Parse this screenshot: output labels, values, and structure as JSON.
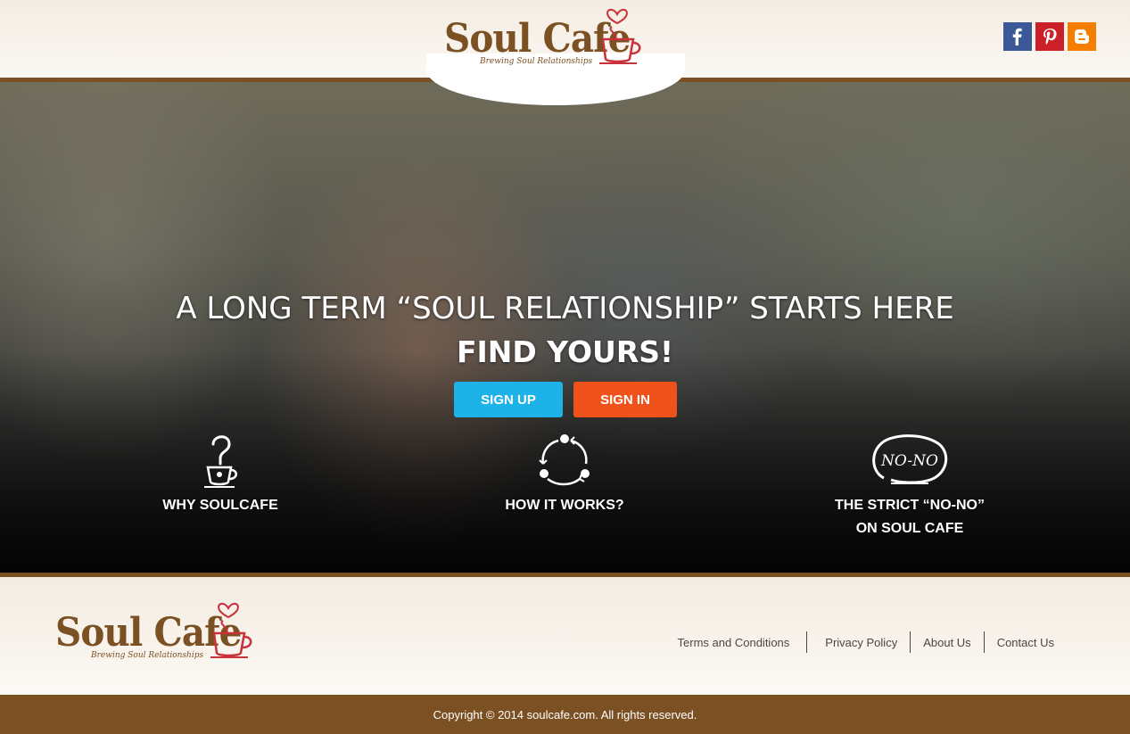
{
  "header": {
    "logo": {
      "word": "Soul Cafe",
      "tagline": "Brewing Soul Relationships"
    },
    "social": [
      {
        "name": "facebook",
        "icon": "facebook-icon",
        "color": "#3b5998"
      },
      {
        "name": "pinterest",
        "icon": "pinterest-icon",
        "color": "#cb2027"
      },
      {
        "name": "blogger",
        "icon": "blogger-icon",
        "color": "#f57d00"
      }
    ]
  },
  "hero": {
    "title": "A LONG TERM “SOUL RELATIONSHIP” STARTS HERE",
    "subtitle": "FIND YOURS!",
    "signup_label": "SIGN UP",
    "signin_label": "SIGN IN",
    "features": [
      {
        "label": "WHY SOULCAFE",
        "icon": "coffee-question-icon"
      },
      {
        "label": "HOW IT WORKS?",
        "icon": "cycle-icon"
      },
      {
        "label_line1": "THE STRICT “NO-NO”",
        "label_line2": "ON SOUL CAFE",
        "icon": "no-no-icon",
        "icon_text": "NO-NO"
      }
    ]
  },
  "footer": {
    "logo": {
      "word": "Soul Cafe",
      "tagline": "Brewing Soul Relationships"
    },
    "links": [
      "Terms and Conditions",
      "Privacy Policy",
      "About Us",
      "Contact Us"
    ],
    "copyright": "Copyright © 2014 soulcafe.com. All rights reserved."
  },
  "colors": {
    "brown": "#7b5022",
    "signup": "#1db3e9",
    "signin": "#f0521c",
    "cup_red": "#c8323a"
  }
}
